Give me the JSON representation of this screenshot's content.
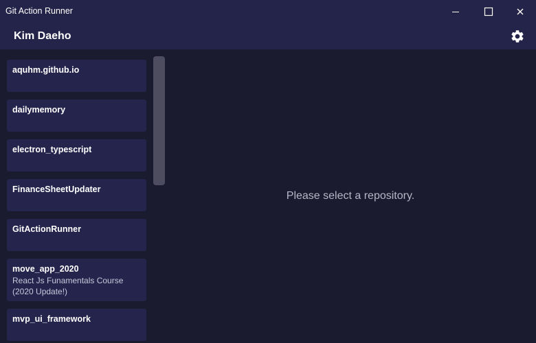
{
  "window": {
    "title": "Git Action Runner",
    "controls": [
      "minimize-icon",
      "maximize-icon",
      "close-icon"
    ]
  },
  "header": {
    "user_name": "Kim Daeho",
    "settings_icon": "gear-icon"
  },
  "repositories": [
    {
      "name": "aquhm.github.io",
      "description": ""
    },
    {
      "name": "dailymemory",
      "description": ""
    },
    {
      "name": "electron_typescript",
      "description": ""
    },
    {
      "name": "FinanceSheetUpdater",
      "description": ""
    },
    {
      "name": "GitActionRunner",
      "description": ""
    },
    {
      "name": "move_app_2020",
      "description": "React Js Funamentals Course (2020 Update!)"
    },
    {
      "name": "mvp_ui_framework",
      "description": ""
    }
  ],
  "main": {
    "placeholder": "Please select a repository."
  },
  "colors": {
    "background": "#1b1b2f",
    "titlebar": "#24234a",
    "card": "#25244c",
    "scrollbar": "#4d4d5f",
    "placeholder_text": "#b7b7c6"
  }
}
